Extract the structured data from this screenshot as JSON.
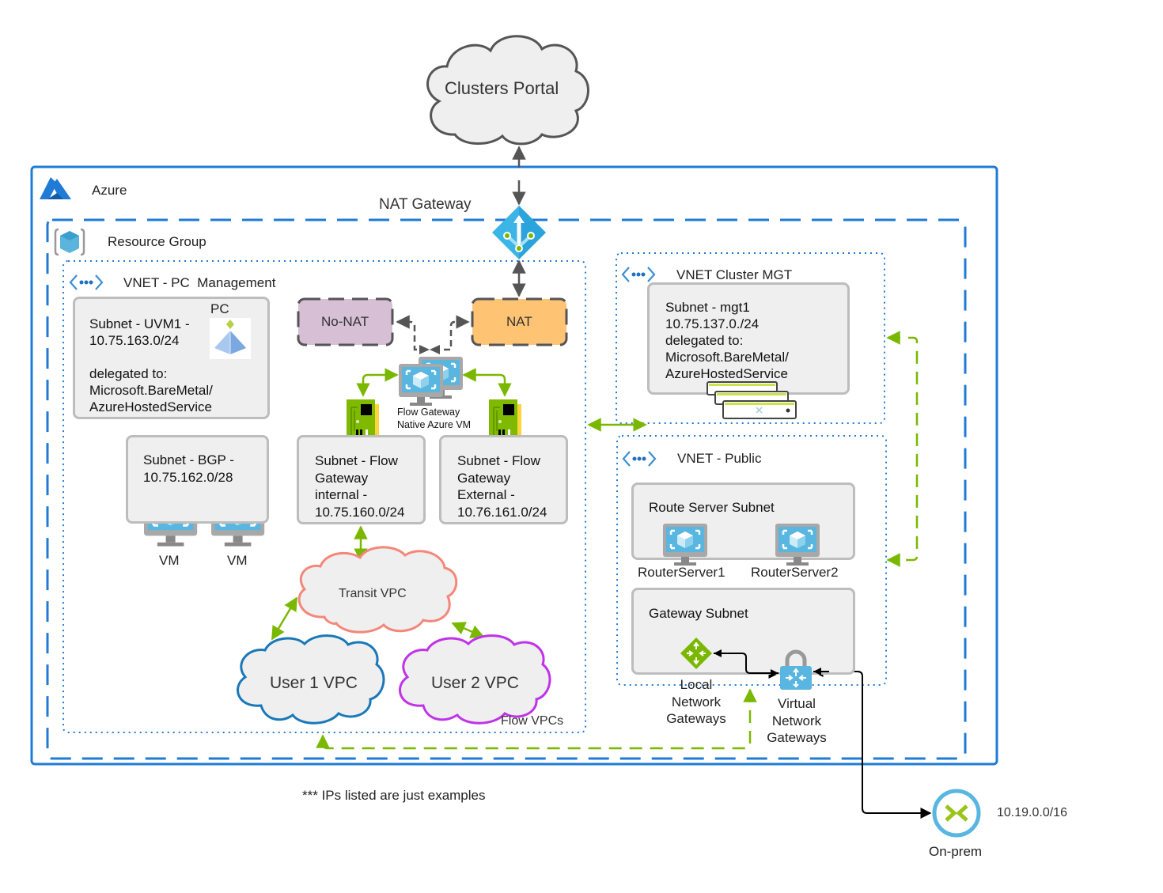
{
  "title": "Azure network architecture diagram",
  "top": {
    "clusters_portal": "Clusters Portal"
  },
  "containers": {
    "azure": "Azure",
    "nat_gateway": "NAT Gateway",
    "resource_group": "Resource Group",
    "vnet_pc_management": "VNET - PC  Management",
    "vnet_cluster_mgt": "VNET Cluster MGT",
    "vnet_public": "VNET - Public",
    "flow_vpcs": "Flow VPCs"
  },
  "nat_boxes": {
    "no_nat": "No-NAT",
    "nat": "NAT"
  },
  "subnets": {
    "uvm1": {
      "lines": [
        "Subnet - UVM1 -",
        "10.75.163.0/24",
        "",
        "delegated to:",
        "Microsoft.BareMetal/",
        "AzureHostedService"
      ],
      "icon_label": "PC"
    },
    "bgp": {
      "lines": [
        "Subnet - BGP -",
        "10.75.162.0/28"
      ],
      "vm_labels": [
        "VM",
        "VM"
      ]
    },
    "fgw_internal": {
      "lines": [
        "Subnet - Flow",
        "Gateway",
        "internal -",
        "10.75.160.0/24"
      ]
    },
    "fgw_external": {
      "lines": [
        "Subnet - Flow",
        "Gateway",
        "External -",
        "10.76.161.0/24"
      ]
    },
    "mgt1": {
      "lines": [
        "Subnet - mgt1",
        "10.75.137.0./24",
        "delegated to:",
        "Microsoft.BareMetal/",
        "AzureHostedService"
      ]
    },
    "route_server": {
      "title": "Route Server Subnet",
      "servers": [
        "RouterServer1",
        "RouterServer2"
      ]
    },
    "gateway": {
      "title": "Gateway Subnet"
    }
  },
  "flow_gateway_vm": [
    "Flow Gateway",
    "Native Azure VM"
  ],
  "vpcs": {
    "transit": "Transit VPC",
    "user1": "User 1 VPC",
    "user2": "User 2 VPC"
  },
  "gateways": {
    "local": [
      "Local",
      "Network",
      "Gateways"
    ],
    "virtual": [
      "Virtual",
      "Network",
      "Gateways"
    ]
  },
  "onprem": {
    "label": "On-prem",
    "cidr": "10.19.0.0/16"
  },
  "footnote": "*** IPs listed are just examples",
  "colors": {
    "azure_blue": "#1f7bd6",
    "arrow_green": "#7ab800",
    "arrow_gray": "#5a5a5a",
    "no_nat_fill": "#d7bfd5",
    "nat_fill": "#ffc374",
    "transit_outline": "#f4877a",
    "user1_outline": "#1a78b8",
    "user2_outline": "#c033e8",
    "subnet_fill": "#efefef",
    "subnet_border": "#bdbdbd"
  }
}
